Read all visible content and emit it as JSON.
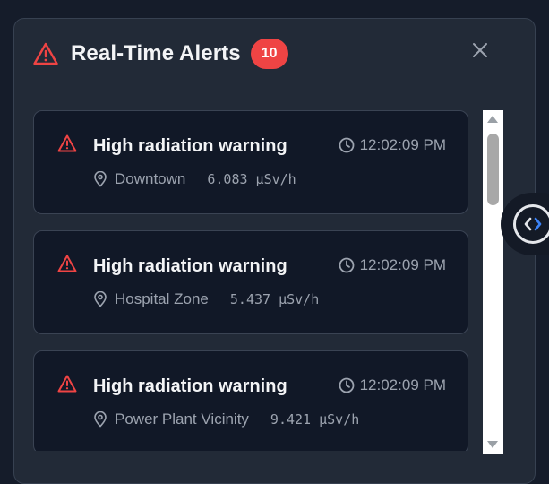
{
  "header": {
    "title": "Real-Time Alerts",
    "badge_count": "10",
    "icon": "alert-triangle-icon"
  },
  "close": {
    "icon": "close-icon"
  },
  "alerts": [
    {
      "title": "High radiation warning",
      "time": "12:02:09 PM",
      "location": "Downtown",
      "value": "6.083 µSv/h"
    },
    {
      "title": "High radiation warning",
      "time": "12:02:09 PM",
      "location": "Hospital Zone",
      "value": "5.437 µSv/h"
    },
    {
      "title": "High radiation warning",
      "time": "12:02:09 PM",
      "location": "Power Plant Vicinity",
      "value": "9.421 µSv/h"
    }
  ],
  "side_toggle": {
    "icon": "code-brackets-icon"
  },
  "colors": {
    "accent_red": "#ef4444",
    "panel_bg": "#222a37",
    "card_bg": "#111827",
    "muted_text": "#9ca3af"
  }
}
